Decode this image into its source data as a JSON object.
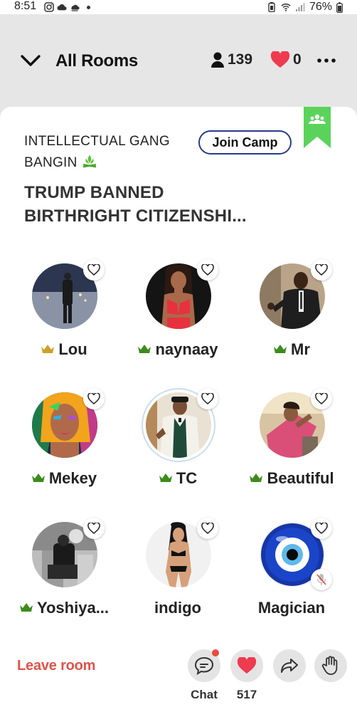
{
  "status_bar": {
    "time": "8:51",
    "battery": "76%"
  },
  "header": {
    "title": "All Rooms",
    "listener_count": "139",
    "like_count": "0"
  },
  "room": {
    "club_name": "INTELLECTUAL GANG BANGIN",
    "join_button": "Join Camp",
    "topic_line1": "TRUMP BANNED",
    "topic_line2": "BIRTHRIGHT CITIZENSHI..."
  },
  "speakers": [
    {
      "name": "Lou",
      "crown": true,
      "crown_color": "#c9a227"
    },
    {
      "name": "naynaay",
      "crown": true,
      "crown_color": "#3d8b1c"
    },
    {
      "name": "Mr",
      "crown": true,
      "crown_color": "#3d8b1c"
    },
    {
      "name": "Mekey",
      "crown": true,
      "crown_color": "#3d8b1c"
    },
    {
      "name": "TC",
      "crown": true,
      "crown_color": "#3d8b1c"
    },
    {
      "name": "Beautiful",
      "crown": true,
      "crown_color": "#3d8b1c"
    },
    {
      "name": "Yoshiya...",
      "crown": true,
      "crown_color": "#3d8b1c"
    },
    {
      "name": "indigo",
      "crown": false
    },
    {
      "name": "Magician",
      "crown": false,
      "muted": true
    }
  ],
  "bottom_bar": {
    "leave_label": "Leave room",
    "chat_label": "Chat",
    "like_total": "517"
  },
  "colors": {
    "accent_red": "#e0534a",
    "heart_red": "#ef3b4f",
    "ribbon_green": "#5bd35b",
    "join_border": "#2a3a8a"
  }
}
